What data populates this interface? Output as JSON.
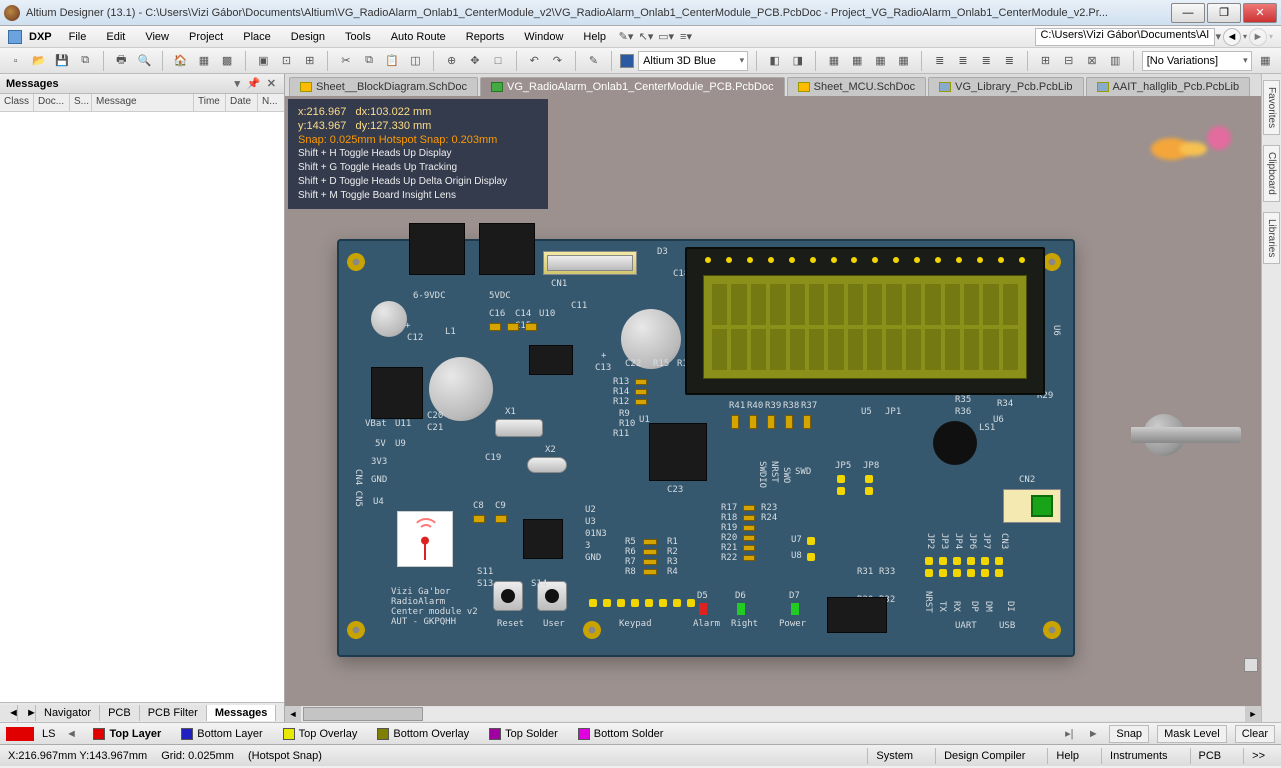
{
  "window": {
    "title": "Altium Designer (13.1) - C:\\Users\\Vizi Gábor\\Documents\\Altium\\VG_RadioAlarm_Onlab1_CenterModule_v2\\VG_RadioAlarm_Onlab1_CenterModule_PCB.PcbDoc - Project_VG_RadioAlarm_Onlab1_CenterModule_v2.Pr..."
  },
  "menu": {
    "dxp": "DXP",
    "items": [
      "File",
      "Edit",
      "View",
      "Project",
      "Place",
      "Design",
      "Tools",
      "Auto Route",
      "Reports",
      "Window",
      "Help"
    ],
    "right_path": "C:\\Users\\Vizi Gábor\\Documents\\Al"
  },
  "toolbar": {
    "color_scheme": "Altium 3D Blue",
    "variations": "[No Variations]"
  },
  "messages_panel": {
    "title": "Messages",
    "columns": [
      "Class",
      "Doc...",
      "S...",
      "Message",
      "Time",
      "Date",
      "N..."
    ]
  },
  "left_tabs": {
    "items": [
      "Navigator",
      "PCB",
      "PCB Filter",
      "Messages"
    ],
    "active": 3
  },
  "doc_tabs": [
    {
      "label": "Sheet__BlockDiagram.SchDoc",
      "active": false
    },
    {
      "label": "VG_RadioAlarm_Onlab1_CenterModule_PCB.PcbDoc",
      "active": true
    },
    {
      "label": "Sheet_MCU.SchDoc",
      "active": false
    },
    {
      "label": "VG_Library_Pcb.PcbLib",
      "active": false
    },
    {
      "label": "AAIT_hallglib_Pcb.PcbLib",
      "active": false
    }
  ],
  "hud": {
    "x": "x:216.967",
    "dx": "dx:103.022  mm",
    "y": "y:143.967",
    "dy": "dy:127.330  mm",
    "snap": "Snap: 0.025mm Hotspot Snap: 0.203mm",
    "hints": [
      "Shift + H   Toggle Heads Up Display",
      "Shift + G   Toggle Heads Up Tracking",
      "Shift + D   Toggle Heads Up Delta Origin Display",
      "Shift + M  Toggle Board Insight Lens"
    ]
  },
  "board_silk": {
    "vendor1": "6-9VDC",
    "vendor2": "5VDC",
    "cn1": "CN1",
    "u11": "U11",
    "vbat": "VBat",
    "5v": "5V",
    "3v3": "3V3",
    "gnd": "GND",
    "u9": "U9",
    "u4": "U4",
    "c12": "C12",
    "l1": "L1",
    "c13": "C13",
    "c15": "C15",
    "c14": "C14",
    "c16": "C16",
    "u10": "U10",
    "c11": "C11",
    "c20": "C20",
    "c19": "C19",
    "x1": "X1",
    "c21": "C21",
    "x2": "X2",
    "r13": "R13",
    "r14": "R14",
    "r12": "R12",
    "r9": "R9",
    "r10": "R10",
    "r11": "R11",
    "u1": "U1",
    "d3": "D3",
    "c18": "C18",
    "c22": "C22",
    "r15": "R15",
    "r16": "R16",
    "c23": "C23",
    "u2": "U2",
    "u3": "U3",
    "c8": "C8",
    "c9": "C9",
    "01n3": "01N3",
    "r5": "R5",
    "r6": "R6",
    "r7": "R7",
    "r8": "R8",
    "r1": "R1",
    "r2": "R2",
    "r3": "R3",
    "r4": "R4",
    "gnd2": "GND",
    "swdio": "SWDIO",
    "nrst": "NRST",
    "swo": "SWO",
    "swd": "SWD",
    "jp5": "JP5",
    "jp8": "JP8",
    "r41": "R41",
    "r40": "R40",
    "r39": "R39",
    "r38": "R38",
    "r37": "R37",
    "r35": "R35",
    "r36": "R36",
    "u5": "U5",
    "jp1": "JP1",
    "r34": "R34",
    "u6": "U6",
    "r29": "R29",
    "ls1": "LS1",
    "cn2": "CN2",
    "r17": "R17",
    "r18": "R18",
    "r19": "R19",
    "r20": "R20",
    "r21": "R21",
    "r22": "R22",
    "r23": "R23",
    "r24": "R24",
    "u7": "U7",
    "u8": "U8",
    "r31": "R31",
    "r33": "R33",
    "r30": "R30",
    "r32": "R32",
    "jp2": "JP2",
    "jp3": "JP3",
    "jp4": "JP4",
    "jp6": "JP6",
    "jp7": "JP7",
    "cn3": "CN3",
    "nrst2": "NRST",
    "tx": "TX",
    "rx": "RX",
    "dp": "DP",
    "dm": "DM",
    "di": "DI",
    "s11": "S11",
    "s13": "S13",
    "s14": "S14",
    "reset_lbl": "Reset",
    "user_lbl": "User",
    "keypad": "Keypad",
    "d5": "D5",
    "d6": "D6",
    "d7": "D7",
    "alarm": "Alarm",
    "right": "Right",
    "power": "Power",
    "uart": "UART",
    "usb": "USB",
    "credit1": "Vizi Ga'bor",
    "credit2": "RadioAlarm",
    "credit3": "Center module v2",
    "credit4": "AUT - GKPQHH",
    "cn4_cn5": "CN4 CN5"
  },
  "layer_bar": {
    "ls": "LS",
    "layers": [
      {
        "name": "Top Layer",
        "color": "#e00000",
        "active": true
      },
      {
        "name": "Bottom Layer",
        "color": "#2020c0",
        "active": false
      },
      {
        "name": "Top Overlay",
        "color": "#e8e800",
        "active": false
      },
      {
        "name": "Bottom Overlay",
        "color": "#808000",
        "active": false
      },
      {
        "name": "Top Solder",
        "color": "#a000a0",
        "active": false
      },
      {
        "name": "Bottom Solder",
        "color": "#e000e0",
        "active": false
      }
    ],
    "right": [
      "Snap",
      "Mask Level",
      "Clear"
    ]
  },
  "right_rail": [
    "Favorites",
    "Clipboard",
    "Libraries"
  ],
  "status": {
    "coord": "X:216.967mm Y:143.967mm",
    "grid": "Grid: 0.025mm",
    "snap": "(Hotspot Snap)",
    "buttons": [
      "System",
      "Design Compiler",
      "Help",
      "Instruments",
      "PCB",
      ">>"
    ]
  }
}
